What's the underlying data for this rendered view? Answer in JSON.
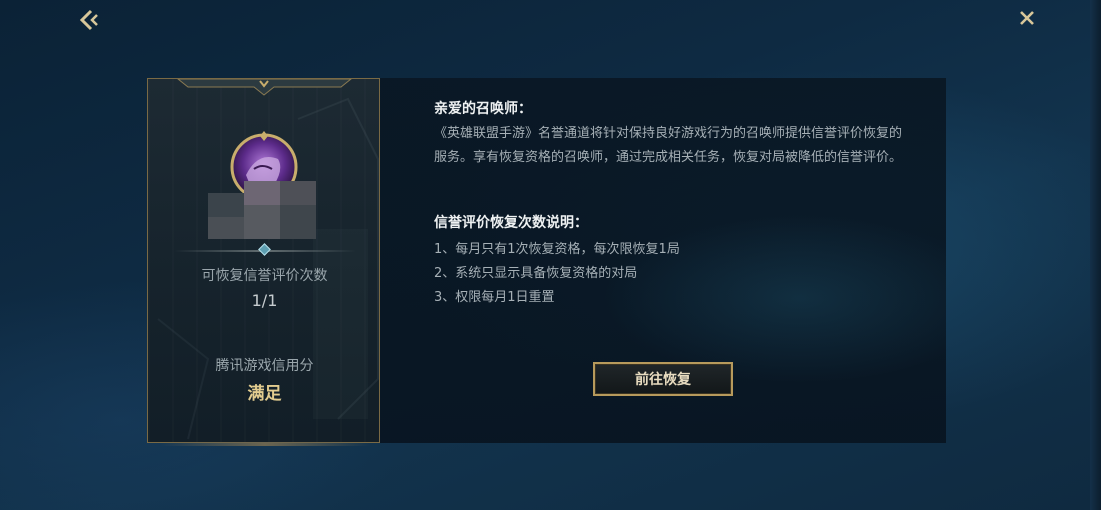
{
  "header": {
    "back_icon": "chevron-left-icon",
    "close_icon": "close-icon"
  },
  "card": {
    "restore_count_label": "可恢复信誉评价次数",
    "restore_count_value": "1/1",
    "credit_label": "腾讯游戏信用分",
    "credit_value": "满足"
  },
  "panel": {
    "greeting": "亲爱的召唤师：",
    "intro": "《英雄联盟手游》名誉通道将针对保持良好游戏行为的召唤师提供信誉评价恢复的服务。享有恢复资格的召唤师，通过完成相关任务，恢复对局被降低的信誉评价。",
    "section_title": "信誉评价恢复次数说明：",
    "rules": [
      "1、每月只有1次恢复资格，每次限恢复1局",
      "2、系统只显示具备恢复资格的对局",
      "3、权限每月1日重置"
    ],
    "button_label": "前往恢复"
  },
  "colors": {
    "accent_gold": "#e2cc8f",
    "border_gold": "#b79a5c",
    "background": "#0e2a42"
  }
}
